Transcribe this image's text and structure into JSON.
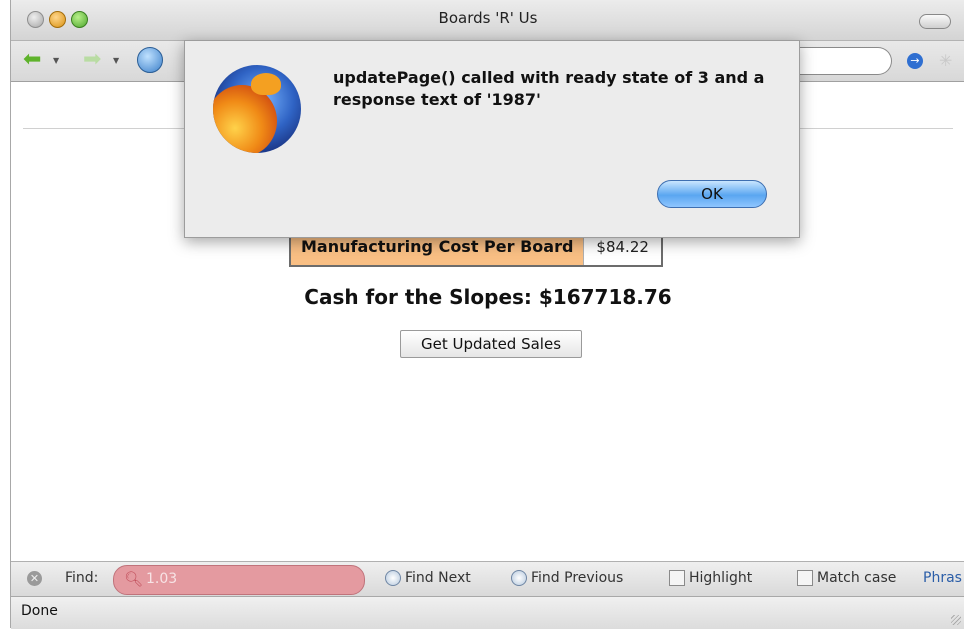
{
  "window": {
    "title": "Boards 'R' Us"
  },
  "page": {
    "cost_label": "Manufacturing Cost Per Board",
    "cost_value": "$84.22",
    "cash_text": "Cash for the Slopes: $167718.76",
    "update_button": "Get Updated Sales"
  },
  "find_bar": {
    "label": "Find:",
    "query": "1.03",
    "find_next": "Find Next",
    "find_previous": "Find Previous",
    "highlight": "Highlight",
    "match_case": "Match case",
    "phrase": "Phras"
  },
  "status": {
    "text": "Done"
  },
  "dialog": {
    "message": "updatePage() called with ready state of 3 and a response text of '1987'",
    "ok": "OK"
  },
  "colors": {
    "accent": "#5aa6f0",
    "table_header": "#f9bf84",
    "find_field": "#e49aa0"
  }
}
